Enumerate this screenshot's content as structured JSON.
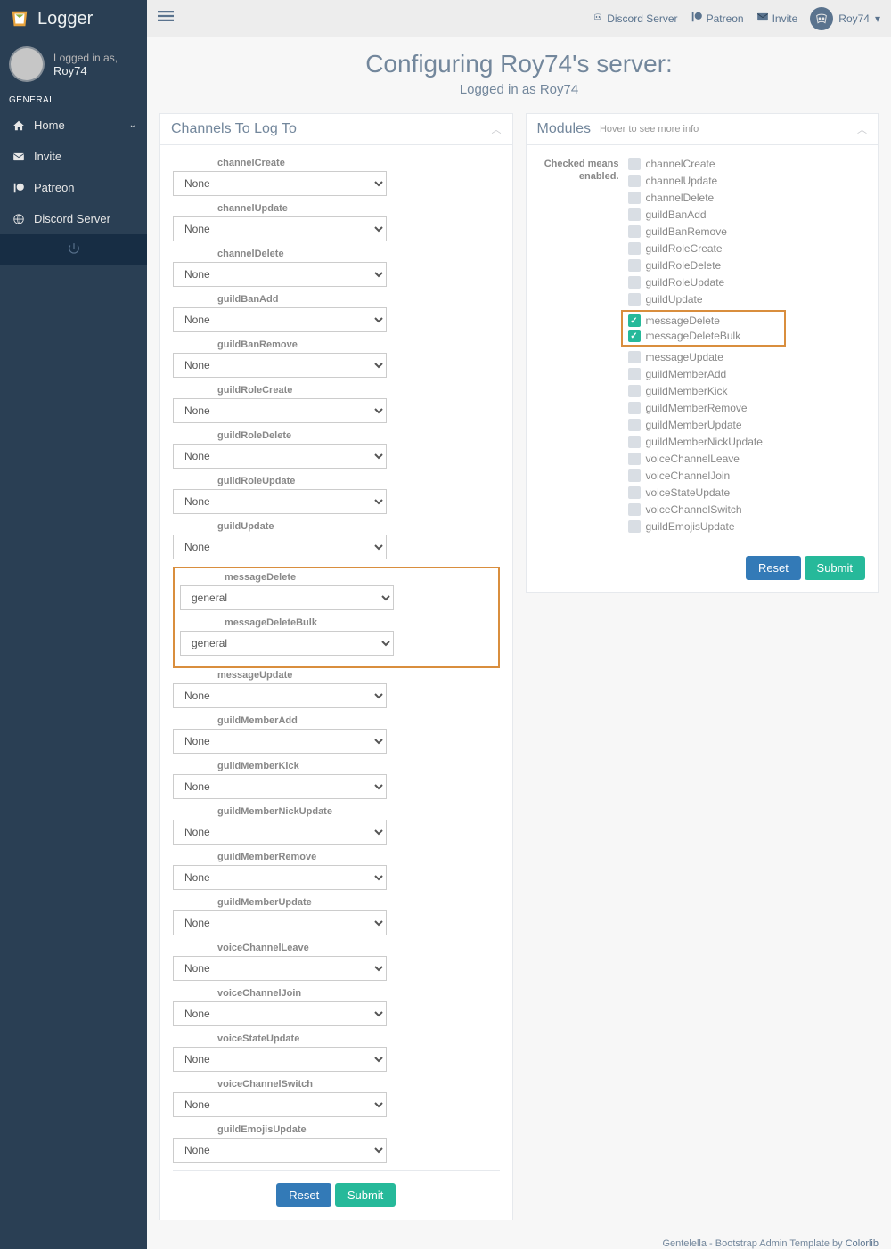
{
  "app_title": "Logger",
  "user": {
    "label": "Logged in as,",
    "name": "Roy74"
  },
  "sidebar": {
    "section": "GENERAL",
    "items": [
      {
        "label": "Home",
        "icon": "home",
        "chev": true
      },
      {
        "label": "Invite",
        "icon": "envelope"
      },
      {
        "label": "Patreon",
        "icon": "patreon"
      },
      {
        "label": "Discord Server",
        "icon": "globe"
      }
    ]
  },
  "topbar": {
    "links": [
      {
        "label": "Discord Server",
        "icon": "discord"
      },
      {
        "label": "Patreon",
        "icon": "patreon"
      },
      {
        "label": "Invite",
        "icon": "envelope"
      }
    ],
    "user": "Roy74"
  },
  "page": {
    "heading": "Configuring Roy74's server:",
    "sub": "Logged in as Roy74"
  },
  "channels_panel": {
    "title": "Channels To Log To",
    "items": [
      {
        "label": "channelCreate",
        "value": "None"
      },
      {
        "label": "channelUpdate",
        "value": "None"
      },
      {
        "label": "channelDelete",
        "value": "None"
      },
      {
        "label": "guildBanAdd",
        "value": "None"
      },
      {
        "label": "guildBanRemove",
        "value": "None"
      },
      {
        "label": "guildRoleCreate",
        "value": "None"
      },
      {
        "label": "guildRoleDelete",
        "value": "None"
      },
      {
        "label": "guildRoleUpdate",
        "value": "None"
      },
      {
        "label": "guildUpdate",
        "value": "None"
      },
      {
        "label": "messageDelete",
        "value": "general",
        "hl": true
      },
      {
        "label": "messageDeleteBulk",
        "value": "general",
        "hl": true
      },
      {
        "label": "messageUpdate",
        "value": "None"
      },
      {
        "label": "guildMemberAdd",
        "value": "None"
      },
      {
        "label": "guildMemberKick",
        "value": "None"
      },
      {
        "label": "guildMemberNickUpdate",
        "value": "None"
      },
      {
        "label": "guildMemberRemove",
        "value": "None"
      },
      {
        "label": "guildMemberUpdate",
        "value": "None"
      },
      {
        "label": "voiceChannelLeave",
        "value": "None"
      },
      {
        "label": "voiceChannelJoin",
        "value": "None"
      },
      {
        "label": "voiceStateUpdate",
        "value": "None"
      },
      {
        "label": "voiceChannelSwitch",
        "value": "None"
      },
      {
        "label": "guildEmojisUpdate",
        "value": "None"
      }
    ],
    "reset": "Reset",
    "submit": "Submit"
  },
  "modules_panel": {
    "title": "Modules",
    "sub": "Hover to see more info",
    "side_label": "Checked means enabled.",
    "items": [
      {
        "label": "channelCreate",
        "checked": false
      },
      {
        "label": "channelUpdate",
        "checked": false
      },
      {
        "label": "channelDelete",
        "checked": false
      },
      {
        "label": "guildBanAdd",
        "checked": false
      },
      {
        "label": "guildBanRemove",
        "checked": false
      },
      {
        "label": "guildRoleCreate",
        "checked": false
      },
      {
        "label": "guildRoleDelete",
        "checked": false
      },
      {
        "label": "guildRoleUpdate",
        "checked": false
      },
      {
        "label": "guildUpdate",
        "checked": false
      },
      {
        "label": "messageDelete",
        "checked": true,
        "hl": true
      },
      {
        "label": "messageDeleteBulk",
        "checked": true,
        "hl": true
      },
      {
        "label": "messageUpdate",
        "checked": false
      },
      {
        "label": "guildMemberAdd",
        "checked": false
      },
      {
        "label": "guildMemberKick",
        "checked": false
      },
      {
        "label": "guildMemberRemove",
        "checked": false
      },
      {
        "label": "guildMemberUpdate",
        "checked": false
      },
      {
        "label": "guildMemberNickUpdate",
        "checked": false
      },
      {
        "label": "voiceChannelLeave",
        "checked": false
      },
      {
        "label": "voiceChannelJoin",
        "checked": false
      },
      {
        "label": "voiceStateUpdate",
        "checked": false
      },
      {
        "label": "voiceChannelSwitch",
        "checked": false
      },
      {
        "label": "guildEmojisUpdate",
        "checked": false
      }
    ],
    "reset": "Reset",
    "submit": "Submit"
  },
  "footer": {
    "text": "Gentelella - Bootstrap Admin Template by ",
    "link": "Colorlib"
  }
}
